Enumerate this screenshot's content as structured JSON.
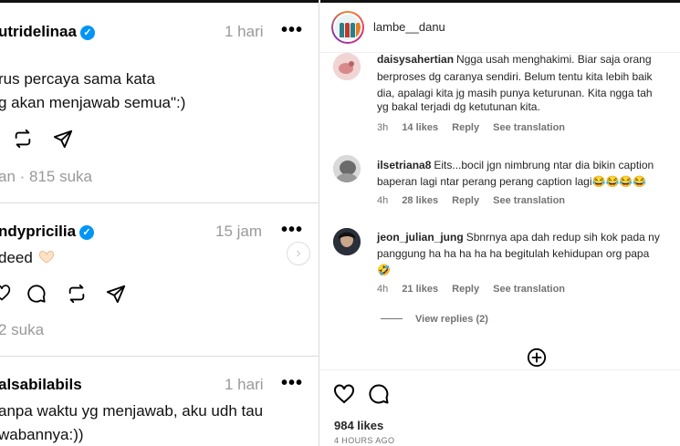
{
  "threads": {
    "posts": [
      {
        "username": "utridelinaa",
        "verified": true,
        "time": "1 hari",
        "lines": [
          "rus percaya sama kata",
          "g akan menjawab semua\":)"
        ],
        "meta": "an · 815 suka"
      },
      {
        "username": "ndypricilia",
        "verified": true,
        "time": "15 jam",
        "lines": [
          "deed"
        ],
        "meta": "2 suka"
      },
      {
        "username": "alsabilabils",
        "verified": false,
        "time": "1 hari",
        "lines": [
          "anpa waktu yg menjawab, aku udh tau",
          "wabannya:))"
        ]
      }
    ],
    "more_label": "•••",
    "next_label": "›"
  },
  "instagram": {
    "account": "lambe__danu",
    "comments": [
      {
        "username": "daisysahertian",
        "lines": [
          "Ngga usah menghakimi. Biar saja orang",
          "berproses dg caranya sendiri. Belum tentu kita lebih baik",
          "dia, apalagi kita jg masih punya keturunan. Kita ngga tah",
          "yg bakal terjadi dg ketutunan kita."
        ],
        "age": "3h",
        "likes": "14 likes",
        "reply": "Reply",
        "translate": "See translation"
      },
      {
        "username": "ilsetriana8",
        "lines": [
          "Eits...bocil jgn nimbrung ntar dia bikin caption",
          "baperan lagi ntar perang perang caption lagi"
        ],
        "emoji_tail": "😂😂😂😂",
        "age": "4h",
        "likes": "28 likes",
        "reply": "Reply",
        "translate": "See translation"
      },
      {
        "username": "jeon_julian_jung",
        "lines": [
          "Sbnrnya apa dah redup sih kok pada ny",
          "panggung ha ha ha ha ha begitulah kehidupan org papa"
        ],
        "emoji_line": "🤣",
        "age": "4h",
        "likes": "21 likes",
        "reply": "Reply",
        "translate": "See translation"
      }
    ],
    "view_replies": "View replies (2)",
    "likes_total": "984 likes",
    "posted_ago": "4 HOURS AGO"
  }
}
